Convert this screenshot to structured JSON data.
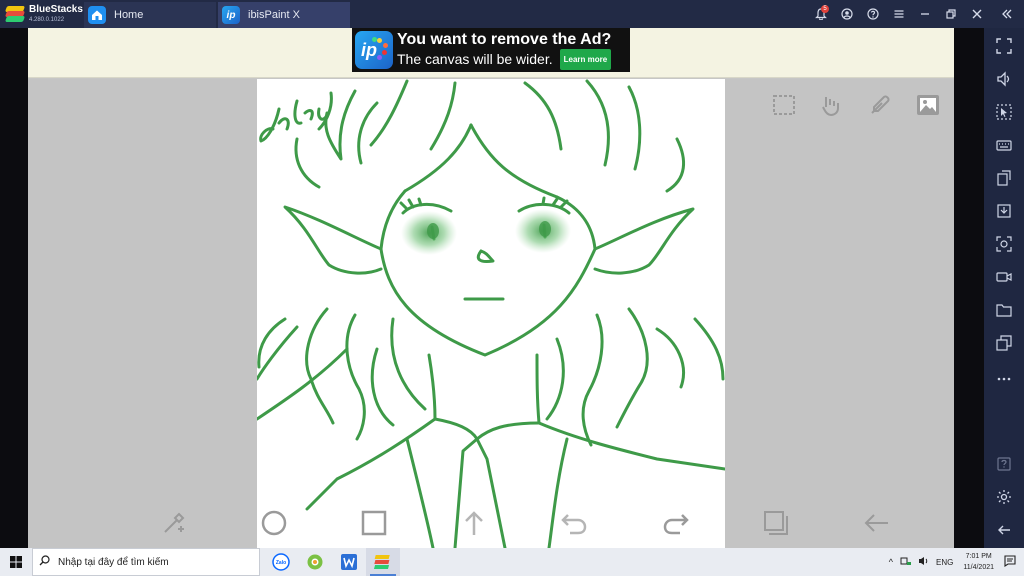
{
  "titlebar": {
    "brand": "BlueStacks",
    "version": "4.280.0.1022",
    "tabs": [
      {
        "label": "Home",
        "icon": "home-icon"
      },
      {
        "label": "ibisPaint X",
        "icon": "ibispaint-icon"
      }
    ],
    "notification_count": "5"
  },
  "ad": {
    "headline": "You want to remove the Ad?",
    "subline": "The canvas will be wider.",
    "button": "Learn more"
  },
  "canvas": {
    "signature": "Jakaj"
  },
  "taskbar": {
    "search_placeholder": "Nhập tại đây để tìm kiếm",
    "language": "ENG",
    "time": "7:01 PM",
    "date": "11/4/2021"
  },
  "colors": {
    "accent_tab": "#36406a",
    "titlebar": "#222a45",
    "sketch_stroke": "#3e9a48",
    "ad_button": "#1fa84a"
  }
}
